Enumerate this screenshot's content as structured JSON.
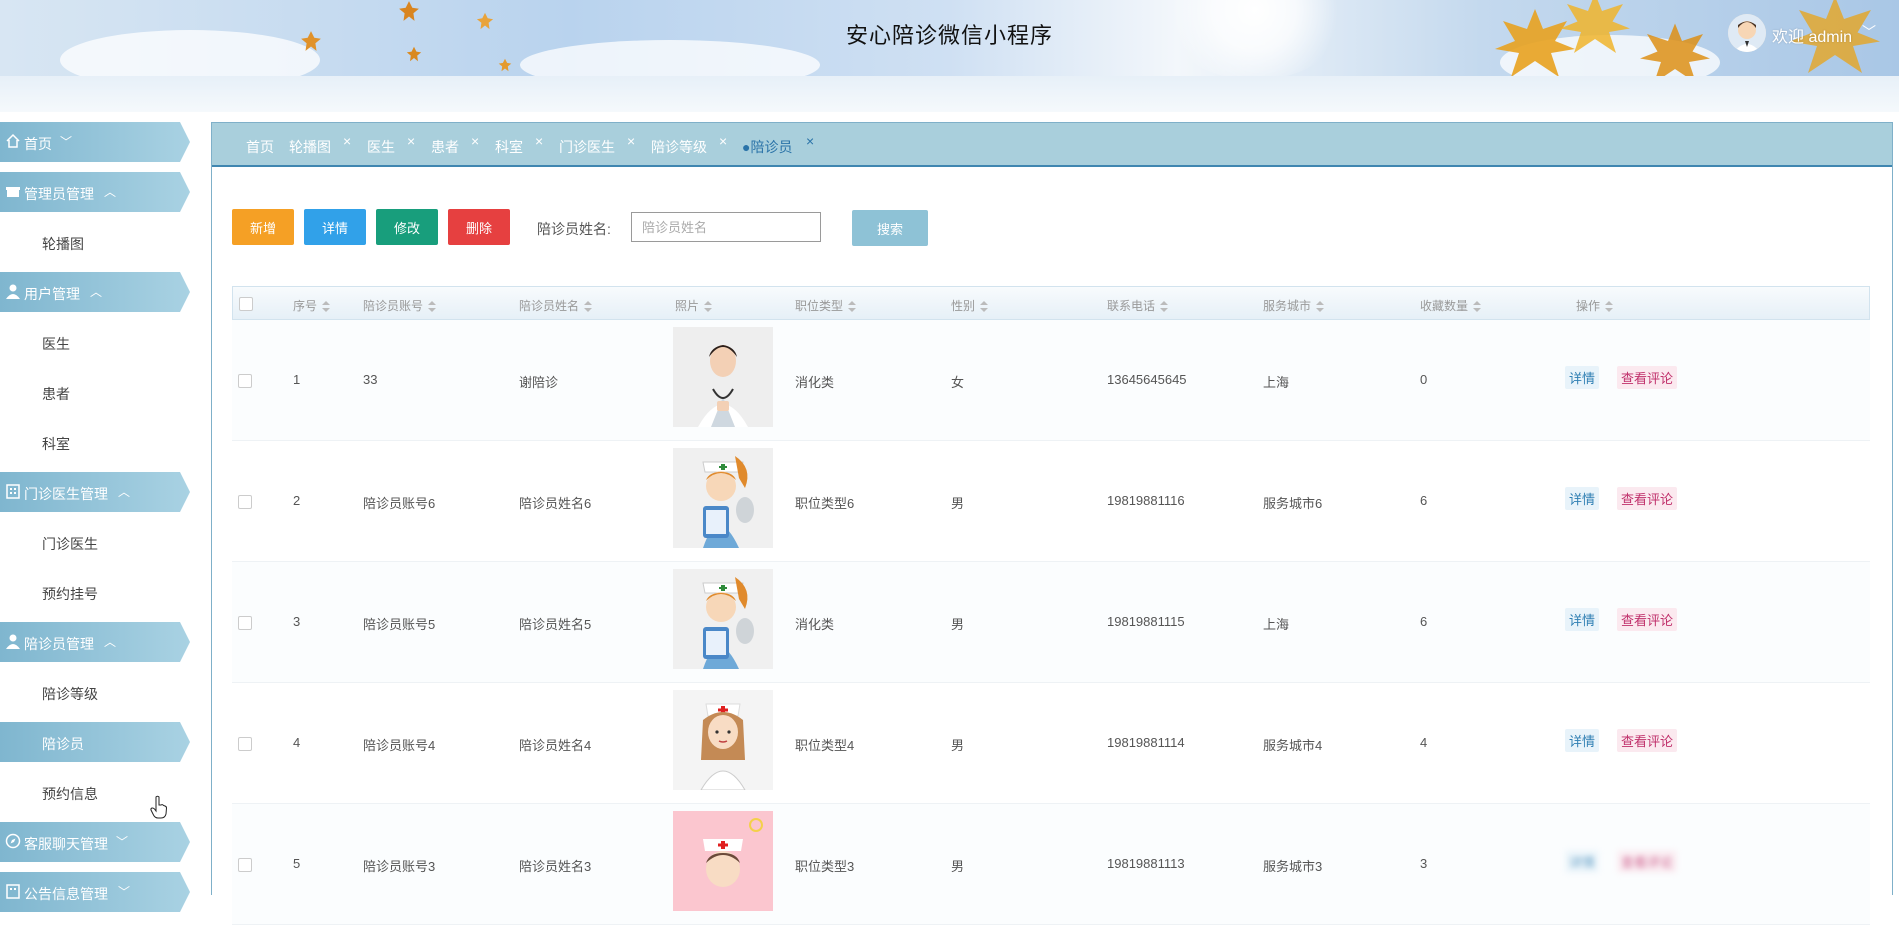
{
  "header": {
    "title": "安心陪诊微信小程序",
    "welcome": "欢迎 admin"
  },
  "sidebar": {
    "items": [
      {
        "label": "首页",
        "type": "top",
        "caret": "﹀"
      },
      {
        "label": "管理员管理",
        "type": "top",
        "caret": "︿"
      },
      {
        "label": "轮播图",
        "type": "sub"
      },
      {
        "label": "用户管理",
        "type": "top",
        "caret": "︿"
      },
      {
        "label": "医生",
        "type": "sub"
      },
      {
        "label": "患者",
        "type": "sub"
      },
      {
        "label": "科室",
        "type": "sub"
      },
      {
        "label": "门诊医生管理",
        "type": "top",
        "caret": "︿"
      },
      {
        "label": "门诊医生",
        "type": "sub"
      },
      {
        "label": "预约挂号",
        "type": "sub"
      },
      {
        "label": "陪诊员管理",
        "type": "top",
        "caret": "︿"
      },
      {
        "label": "陪诊等级",
        "type": "sub"
      },
      {
        "label": "陪诊员",
        "type": "sub",
        "active": true
      },
      {
        "label": "预约信息",
        "type": "sub"
      },
      {
        "label": "客服聊天管理",
        "type": "top",
        "caret": "﹀"
      },
      {
        "label": "公告信息管理",
        "type": "top",
        "caret": "﹀"
      }
    ]
  },
  "tabs": [
    {
      "label": "首页",
      "closable": false
    },
    {
      "label": "轮播图",
      "closable": true
    },
    {
      "label": "医生",
      "closable": true
    },
    {
      "label": "患者",
      "closable": true
    },
    {
      "label": "科室",
      "closable": true
    },
    {
      "label": "门诊医生",
      "closable": true
    },
    {
      "label": "陪诊等级",
      "closable": true
    },
    {
      "label": "●陪诊员",
      "closable": true,
      "active": true
    }
  ],
  "toolbar": {
    "add": "新增",
    "detail": "详情",
    "edit": "修改",
    "delete": "删除",
    "search_label": "陪诊员姓名:",
    "search_placeholder": "陪诊员姓名",
    "search_button": "搜索"
  },
  "table": {
    "columns": [
      "序号",
      "陪诊员账号",
      "陪诊员姓名",
      "照片",
      "职位类型",
      "性别",
      "联系电话",
      "服务城市",
      "收藏数量",
      "操作"
    ],
    "op_detail": "详情",
    "op_review": "查看评论",
    "rows": [
      {
        "no": "1",
        "account": "33",
        "name": "谢陪诊",
        "photo": "doctor-female-photo",
        "type": "消化类",
        "gender": "女",
        "phone": "13645645645",
        "city": "上海",
        "favorites": "0"
      },
      {
        "no": "2",
        "account": "陪诊员账号6",
        "name": "陪诊员姓名6",
        "photo": "nurse-cartoon-photo",
        "type": "职位类型6",
        "gender": "男",
        "phone": "19819881116",
        "city": "服务城市6",
        "favorites": "6"
      },
      {
        "no": "3",
        "account": "陪诊员账号5",
        "name": "陪诊员姓名5",
        "photo": "nurse-cartoon-photo",
        "type": "消化类",
        "gender": "男",
        "phone": "19819881115",
        "city": "上海",
        "favorites": "6"
      },
      {
        "no": "4",
        "account": "陪诊员账号4",
        "name": "陪诊员姓名4",
        "photo": "nurse-girl-photo",
        "type": "职位类型4",
        "gender": "男",
        "phone": "19819881114",
        "city": "服务城市4",
        "favorites": "4"
      },
      {
        "no": "5",
        "account": "陪诊员账号3",
        "name": "陪诊员姓名3",
        "photo": "nurse-pink-photo",
        "type": "职位类型3",
        "gender": "男",
        "phone": "19819881113",
        "city": "服务城市3",
        "favorites": "3"
      }
    ]
  },
  "colors": {
    "menu_bg": "#7fb6cf",
    "tab_bar": "#a9cfdc",
    "add": "#f5a025",
    "detail": "#31a1e9",
    "edit": "#189e7c",
    "delete": "#e64040",
    "search": "#8ec2d6"
  }
}
